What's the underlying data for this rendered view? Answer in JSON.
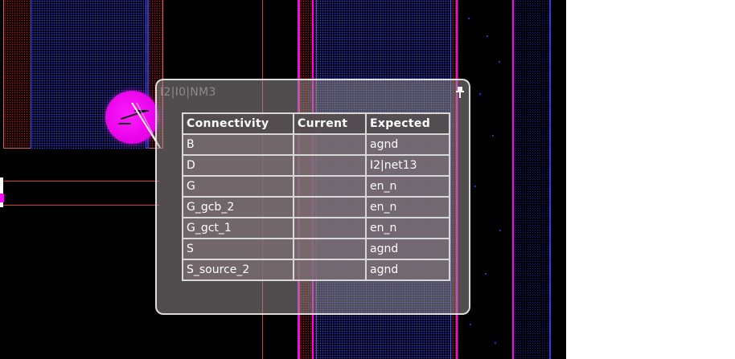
{
  "popup": {
    "title": "I2|I0|NM3",
    "pin_icon": "pin-icon"
  },
  "table": {
    "headers": {
      "connectivity": "Connectivity",
      "current": "Current",
      "expected": "Expected"
    },
    "rows": [
      {
        "connectivity": "B",
        "current": "",
        "expected": "agnd"
      },
      {
        "connectivity": "D",
        "current": "",
        "expected": "I2|net13"
      },
      {
        "connectivity": "G",
        "current": "",
        "expected": "en_n"
      },
      {
        "connectivity": "G_gcb_2",
        "current": "",
        "expected": "en_n"
      },
      {
        "connectivity": "G_gct_1",
        "current": "",
        "expected": "en_n"
      },
      {
        "connectivity": "S",
        "current": "",
        "expected": "agnd"
      },
      {
        "connectivity": "S_source_2",
        "current": "",
        "expected": "agnd"
      }
    ]
  },
  "colors": {
    "canvas_background": "#000000",
    "probe_highlight": "#ff00ff",
    "red_layer": "#ff3030",
    "blue_layer": "#3f52ff",
    "magenta_wire": "#ff00ff"
  },
  "icons": {
    "probe": "probe-icon",
    "pin": "pin-icon"
  }
}
